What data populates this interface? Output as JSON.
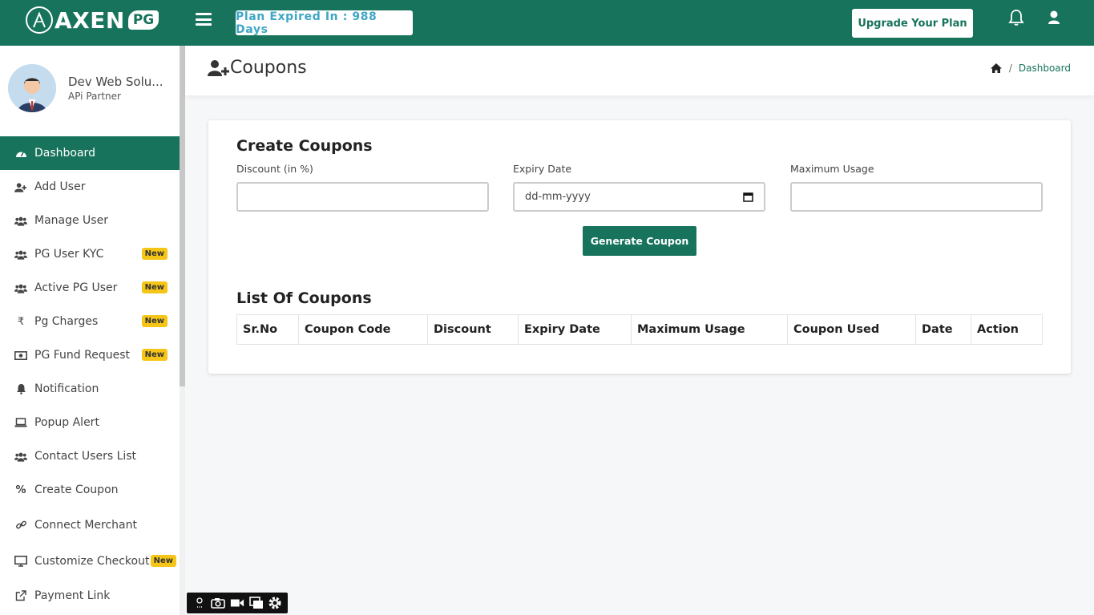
{
  "brand": {
    "name": "AXEN",
    "suffix": "PG"
  },
  "topbar": {
    "plan_text": "Plan Expired In : 988 Days",
    "upgrade_label": "Upgrade Your Plan"
  },
  "profile": {
    "name": "Dev Web Solu...",
    "role": "APi Partner"
  },
  "sidebar": {
    "items": [
      {
        "label": "Dashboard",
        "icon": "dashboard-icon",
        "active": true
      },
      {
        "label": "Add User",
        "icon": "user-plus-icon"
      },
      {
        "label": "Manage User",
        "icon": "users-icon"
      },
      {
        "label": "PG User KYC",
        "icon": "users-icon",
        "badge": "New"
      },
      {
        "label": "Active PG User",
        "icon": "users-icon",
        "badge": "New"
      },
      {
        "label": "Pg Charges",
        "icon": "rupee-icon",
        "badge": "New"
      },
      {
        "label": "PG Fund Request",
        "icon": "money-icon",
        "badge": "New"
      },
      {
        "label": "Notification",
        "icon": "bell-icon"
      },
      {
        "label": "Popup Alert",
        "icon": "laptop-icon"
      },
      {
        "label": "Contact Users List",
        "icon": "users-icon"
      },
      {
        "label": "Create Coupon",
        "icon": "percent-icon"
      },
      {
        "label": "Connect Merchant",
        "icon": "link-icon"
      },
      {
        "label": "Customize Checkout",
        "icon": "monitor-icon",
        "badge": "New"
      },
      {
        "label": "Payment Link",
        "icon": "external-link-icon"
      }
    ]
  },
  "page": {
    "title": "Coupons",
    "breadcrumb": "Dashboard"
  },
  "form": {
    "heading": "Create Coupons",
    "discount_label": "Discount (in %)",
    "expiry_label": "Expiry Date",
    "expiry_placeholder": "dd-mm-yyyy",
    "usage_label": "Maximum Usage",
    "generate_label": "Generate Coupon"
  },
  "list": {
    "heading": "List Of Coupons",
    "columns": [
      "Sr.No",
      "Coupon Code",
      "Discount",
      "Expiry Date",
      "Maximum Usage",
      "Coupon Used",
      "Date",
      "Action"
    ]
  },
  "colors": {
    "primary": "#17735c",
    "plan_text": "#3fa6c5",
    "badge": "#f5c518"
  }
}
